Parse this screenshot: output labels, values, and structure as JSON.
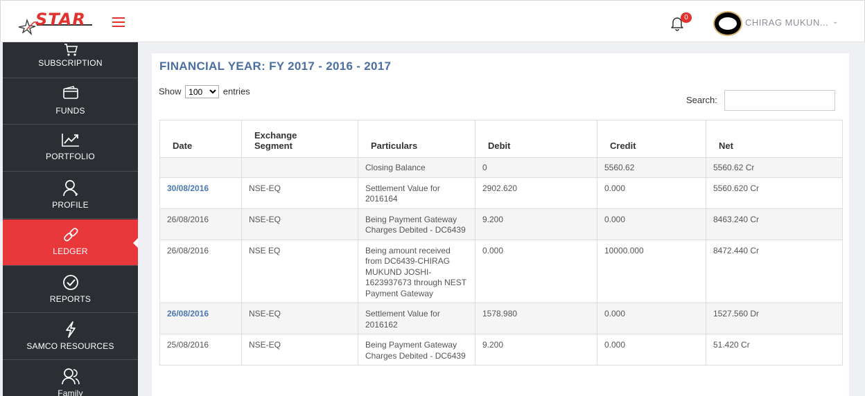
{
  "header": {
    "logo_text": "STAR",
    "notification_count": "0",
    "user_name": "CHIRAG MUKUN...",
    "accent_color": "#e8383c"
  },
  "sidebar": {
    "items": [
      {
        "label": "SUBSCRIPTION",
        "icon": "cart-icon"
      },
      {
        "label": "FUNDS",
        "icon": "wallet-icon"
      },
      {
        "label": "PORTFOLIO",
        "icon": "chart-line-icon"
      },
      {
        "label": "PROFILE",
        "icon": "user-icon"
      },
      {
        "label": "LEDGER",
        "icon": "link-icon",
        "active": true
      },
      {
        "label": "REPORTS",
        "icon": "check-circle-icon"
      },
      {
        "label": "SAMCO RESOURCES",
        "icon": "lightning-icon"
      },
      {
        "label": "Family",
        "icon": "users-icon"
      }
    ]
  },
  "main": {
    "title": "FINANCIAL YEAR: FY 2017 - 2016 - 2017",
    "show_label": "Show",
    "entries_value": "100",
    "entries_label": "entries",
    "search_label": "Search:",
    "table": {
      "headers": [
        "Date",
        "Exchange Segment",
        "Particulars",
        "Debit",
        "Credit",
        "Net"
      ],
      "rows": [
        {
          "date": "",
          "segment": "",
          "particulars": "Closing Balance",
          "debit": "0",
          "credit": "5560.62",
          "net": "5560.62 Cr"
        },
        {
          "date": "30/08/2016",
          "segment": "NSE-EQ",
          "particulars": "Settlement Value for 2016164",
          "debit": "2902.620",
          "credit": "0.000",
          "net": "5560.620 Cr"
        },
        {
          "date": "26/08/2016",
          "segment": "NSE-EQ",
          "particulars": "Being Payment Gateway Charges Debited - DC6439",
          "debit": "9.200",
          "credit": "0.000",
          "net": "8463.240 Cr"
        },
        {
          "date": "26/08/2016",
          "segment": "NSE EQ",
          "particulars": "Being amount received from DC6439-CHIRAG MUKUND JOSHI-1623937673 through NEST Payment Gateway",
          "debit": "0.000",
          "credit": "10000.000",
          "net": "8472.440 Cr"
        },
        {
          "date": "26/08/2016",
          "segment": "NSE-EQ",
          "particulars": "Settlement Value for 2016162",
          "debit": "1578.980",
          "credit": "0.000",
          "net": "1527.560 Dr"
        },
        {
          "date": "25/08/2016",
          "segment": "NSE-EQ",
          "particulars": "Being Payment Gateway Charges Debited - DC6439",
          "debit": "9.200",
          "credit": "0.000",
          "net": "51.420 Cr"
        }
      ]
    }
  }
}
